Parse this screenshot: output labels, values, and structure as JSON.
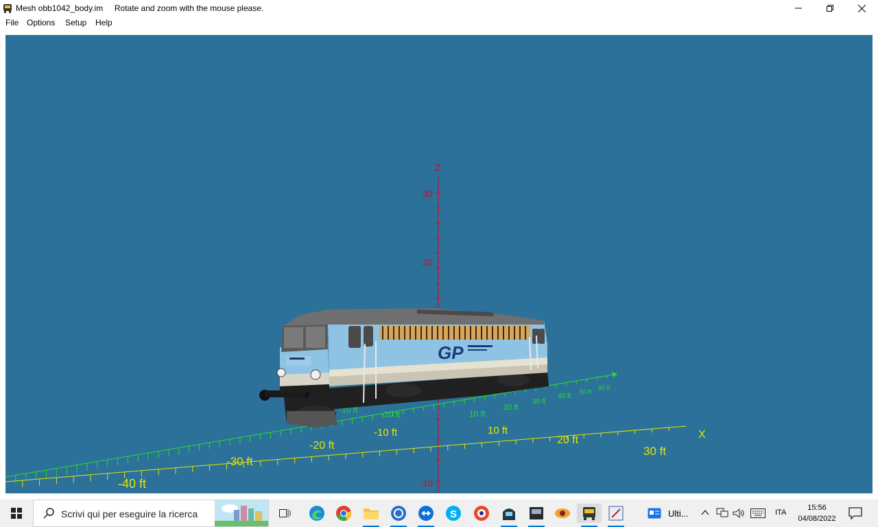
{
  "window": {
    "title": "Mesh obb1042_body.im     Rotate and zoom with the mouse please.",
    "buttons": {
      "minimize": "minimize",
      "maximize": "restore",
      "close": "close"
    }
  },
  "menu": [
    {
      "label": "File"
    },
    {
      "label": "Options"
    },
    {
      "label": "Setup"
    },
    {
      "label": "Help"
    }
  ],
  "viewport": {
    "background": "#2b7199",
    "z_axis": {
      "label": "Z",
      "ticks": [
        "30",
        "20",
        "-10"
      ],
      "color": "#c0102a"
    },
    "x_axis": {
      "label": "X",
      "ticks": [
        "-40 ft",
        "-30 ft",
        "-20 ft",
        "-10 ft",
        "10 ft",
        "20 ft",
        "30 ft"
      ],
      "color": "#e6e600"
    },
    "y_axis": {
      "ticks": [
        "-10 ft",
        "-20 ft",
        "10 ft",
        "20 ft",
        "30 ft",
        "40 ft",
        "50 ft",
        "60 ft"
      ],
      "color": "#2cdc2c"
    },
    "model": {
      "name": "obb1042_body",
      "livery": "GP",
      "body_color": "#8fc3e3"
    }
  },
  "taskbar": {
    "search_placeholder": "Scrivi qui per eseguire la ricerca",
    "pinned": [
      "task-view-icon",
      "edge-icon",
      "chrome-icon",
      "file-explorer-icon",
      "network-icon",
      "teamviewer-icon",
      "skype-icon",
      "app-icon",
      "train-icon",
      "locomotive-icon",
      "eye-icon",
      "train-sim-icon",
      "editor-icon"
    ],
    "ulti_label": "Ulti...",
    "language": "ITA",
    "time": "15:56",
    "date": "04/08/2022"
  }
}
